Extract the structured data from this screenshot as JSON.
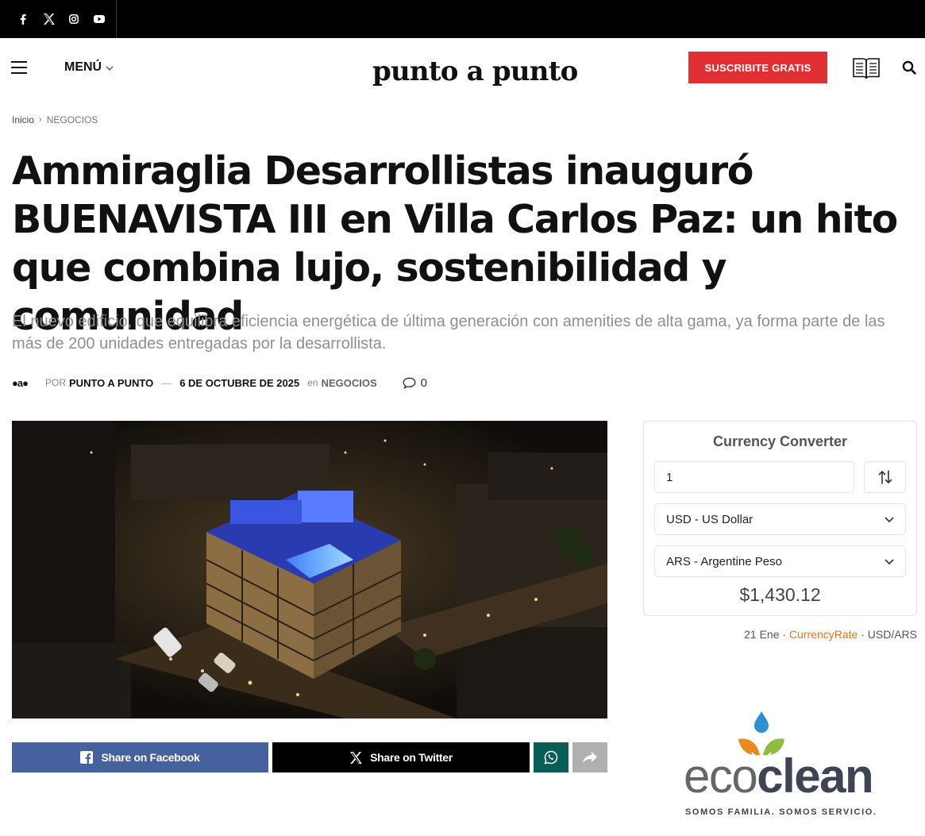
{
  "topbar": {
    "social_icons": [
      "facebook-icon",
      "x-icon",
      "instagram-icon",
      "youtube-icon"
    ]
  },
  "header": {
    "menu_label": "MENÚ",
    "logo": "punto a punto",
    "subscribe_label": "SUSCRIBITE GRATIS"
  },
  "breadcrumb": {
    "home": "Inicio",
    "separator": "›",
    "category": "NEGOCIOS"
  },
  "article": {
    "title": "Ammiraglia Desarrollistas inauguró BUENAVISTA III en Villa Carlos Paz: un hito que combina lujo, sostenibilidad y comunidad",
    "subtitle": "El nuevo edificio, que equilibra eficiencia energética de última generación con amenities de alta gama, ya forma parte de las más de 200 unidades entregadas por la desarrollista.",
    "meta": {
      "avatar_text": "●a●",
      "by": "POR",
      "author": "PUNTO A PUNTO",
      "dash": "—",
      "date": "6 DE OCTUBRE DE 2025",
      "in": "en",
      "category": "NEGOCIOS",
      "comments": "0"
    }
  },
  "share": {
    "facebook": "Share on Facebook",
    "twitter": "Share on Twitter"
  },
  "currency_converter": {
    "title": "Currency Converter",
    "amount": "1",
    "from": "USD - US Dollar",
    "to": "ARS - Argentine Peso",
    "result": "$1,430.12",
    "footer_date": "21 Ene",
    "footer_sep1": " · ",
    "footer_link": "CurrencyRate",
    "footer_sep2": " · ",
    "footer_pair": "USD/ARS"
  },
  "ad": {
    "brand_part1": "eco",
    "brand_part2": "clean",
    "tagline": "SOMOS FAMILIA. SOMOS SERVICIO."
  },
  "colors": {
    "subscribe": "#e03033",
    "facebook": "#45629f",
    "twitter": "#000000",
    "whatsapp": "#075e54",
    "link_orange": "#e8731b"
  }
}
